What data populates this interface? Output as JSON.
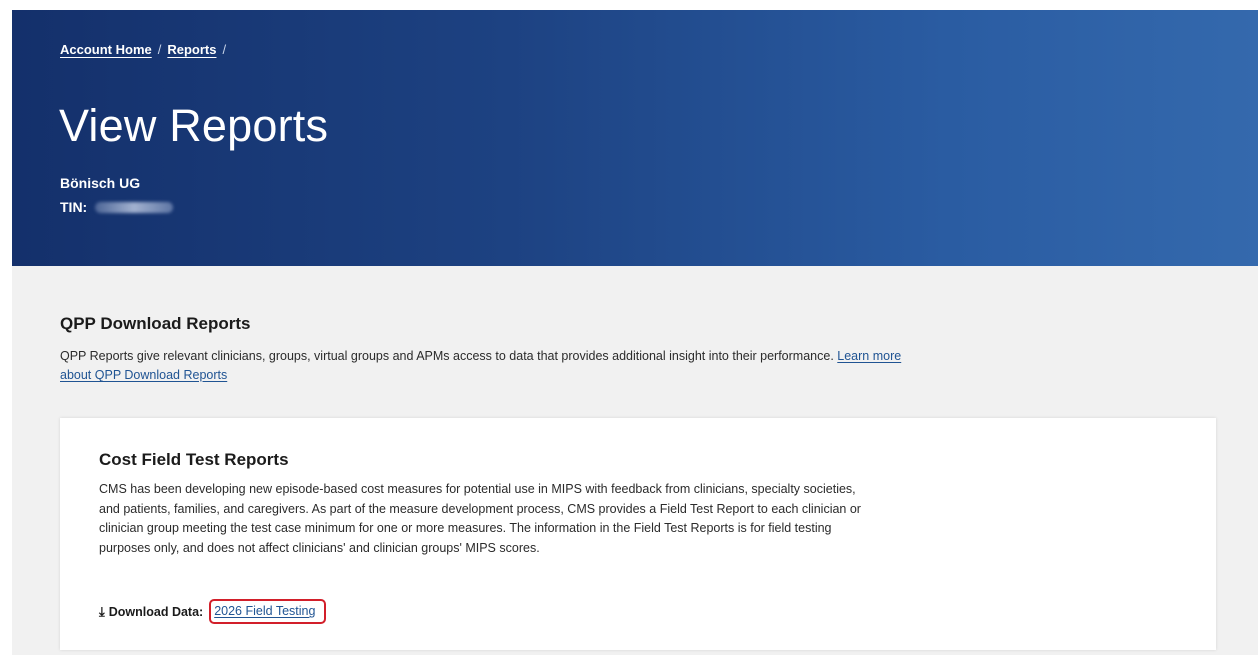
{
  "breadcrumb": {
    "items": [
      {
        "label": "Account Home"
      },
      {
        "label": "Reports"
      }
    ],
    "separator": "/"
  },
  "header": {
    "title": "View Reports",
    "org_name": "Bönisch UG",
    "tin_label": "TIN:"
  },
  "qpp_section": {
    "heading": "QPP Download Reports",
    "description": "QPP Reports give relevant clinicians, groups, virtual groups and APMs access to data that provides additional insight into their performance.",
    "learn_more_link": "Learn more about QPP Download Reports"
  },
  "cost_card": {
    "heading": "Cost Field Test Reports",
    "description": "CMS has been developing new episode-based cost measures for potential use in MIPS with feedback from clinicians, specialty societies, and patients, families, and caregivers. As part of the measure development process, CMS provides a Field Test Report to each clinician or clinician group meeting the test case minimum for one or more measures. The information in the Field Test Reports is for field testing purposes only, and does not affect clinicians' and clinician groups' MIPS scores.",
    "download_label": "Download Data:",
    "download_link": "2026 Field Testing"
  },
  "icons": {
    "download": "download-icon"
  },
  "colors": {
    "hero_dark": "#14306b",
    "hero_light": "#3469ad",
    "link": "#205493",
    "highlight_border": "#d21f2a",
    "page_background": "#f1f1f1"
  }
}
